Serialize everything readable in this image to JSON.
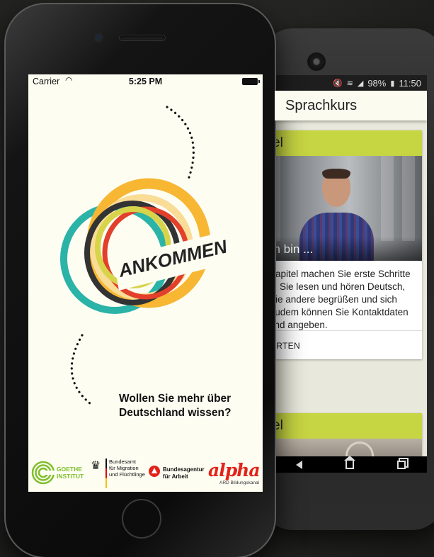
{
  "android": {
    "status": {
      "battery": "98%",
      "time": "11:50"
    },
    "appbar_title": "Sprachkurs",
    "card1": {
      "title": "el",
      "image_caption": "ch bin ...",
      "body_lines": [
        "Kapitel machen Sie erste Schritte",
        "n. Sie lesen und hören Deutsch,",
        "Sie andere begrüßen und sich",
        "Zudem können Sie Kontaktdaten",
        "und angeben."
      ],
      "action_label": "ARTEN"
    },
    "card2": {
      "title": "el"
    },
    "accent_color": "#c6d542"
  },
  "iphone": {
    "status": {
      "carrier": "Carrier",
      "time": "5:25 PM"
    },
    "logo_word": "ANKOMMEN",
    "question_lines": [
      "Wollen Sie mehr über",
      "Deutschland wissen?"
    ],
    "footer": {
      "goethe": [
        "GOETHE",
        "INSTITUT"
      ],
      "bamf": [
        "Bundesamt",
        "für Migration",
        "und Flüchtlinge"
      ],
      "ba": [
        "Bundesagentur",
        "für Arbeit"
      ],
      "alpha": {
        "word": "alpha",
        "sub": "ARD Bildungskanal"
      }
    },
    "ring_colors": [
      "#2bb3a8",
      "#f7b733",
      "#d8d44a",
      "#333333",
      "#e2402b",
      "#f9dc96"
    ]
  }
}
